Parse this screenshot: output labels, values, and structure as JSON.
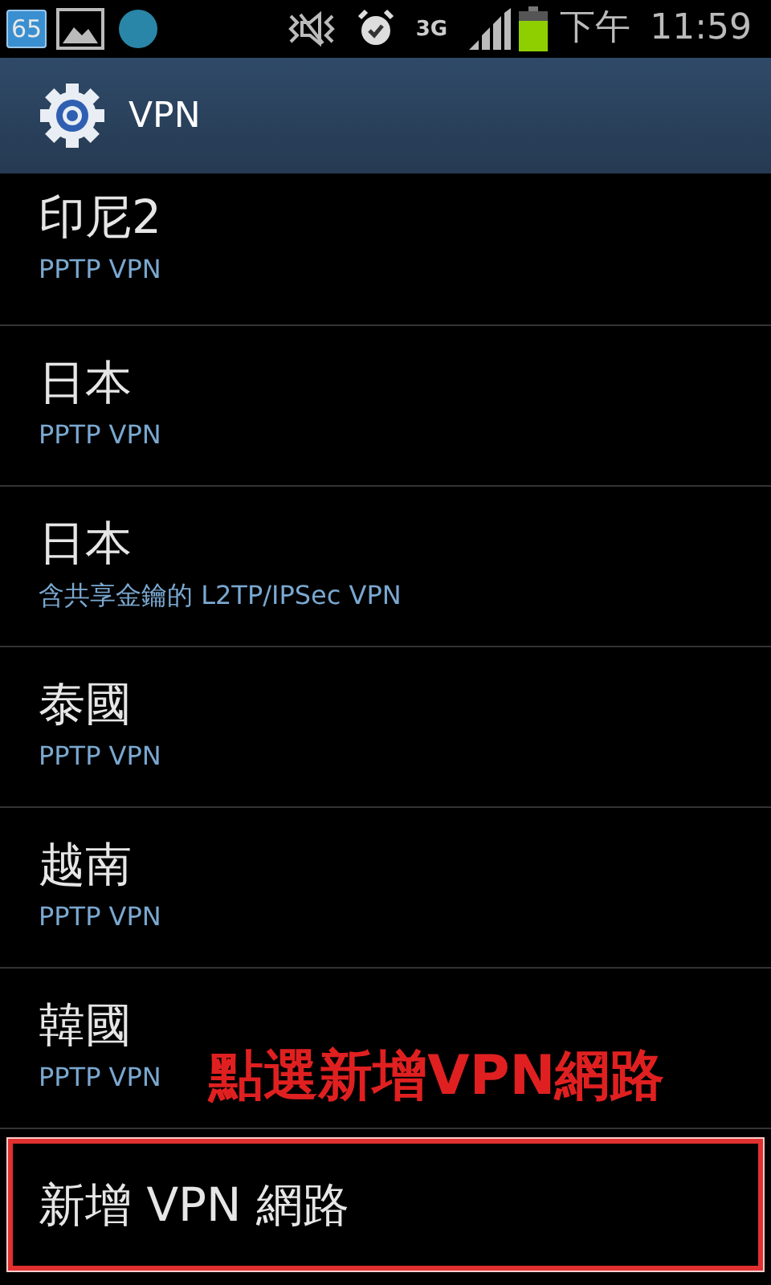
{
  "status_bar": {
    "notification_badge": "65",
    "network": "3G",
    "time_period": "下午",
    "time": "11:59"
  },
  "action_bar": {
    "title": "VPN"
  },
  "vpn_list": [
    {
      "name": "印尼2",
      "type": "PPTP VPN"
    },
    {
      "name": "日本",
      "type": "PPTP VPN"
    },
    {
      "name": "日本",
      "type": "含共享金鑰的 L2TP/IPSec VPN"
    },
    {
      "name": "泰國",
      "type": "PPTP VPN"
    },
    {
      "name": "越南",
      "type": "PPTP VPN"
    },
    {
      "name": "韓國",
      "type": "PPTP VPN"
    }
  ],
  "add_item": {
    "label": "新增 VPN 網路"
  },
  "annotation": {
    "text": "點選新增VPN網路"
  }
}
